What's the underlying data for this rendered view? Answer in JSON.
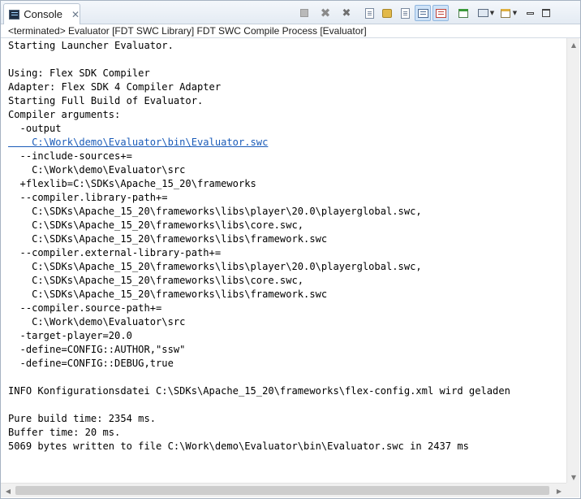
{
  "tab": {
    "label": "Console",
    "close": "✕"
  },
  "toolbar": {
    "buttons": [
      {
        "name": "terminate-button",
        "icon": "stop-icon",
        "pressed": false
      },
      {
        "name": "remove-launch-button",
        "icon": "remove-icon",
        "pressed": false
      },
      {
        "name": "remove-all-terminated-button",
        "icon": "remove-all-icon",
        "pressed": false
      },
      {
        "name": "clear-console-button",
        "icon": "clear-console-icon",
        "pressed": false
      },
      {
        "name": "scroll-lock-button",
        "icon": "scroll-lock-icon",
        "pressed": false
      },
      {
        "name": "word-wrap-button",
        "icon": "word-wrap-icon",
        "pressed": false
      },
      {
        "name": "show-on-stdout-button",
        "icon": "show-stdout-icon",
        "pressed": true
      },
      {
        "name": "show-on-stderr-button",
        "icon": "show-stderr-icon",
        "pressed": true
      },
      {
        "name": "pin-console-button",
        "icon": "pin-console-icon",
        "pressed": false
      },
      {
        "name": "display-console-button",
        "icon": "display-console-icon",
        "pressed": false
      },
      {
        "name": "open-console-button",
        "icon": "open-console-icon",
        "pressed": false
      },
      {
        "name": "minimize-button",
        "icon": "minimize-icon",
        "pressed": false
      },
      {
        "name": "maximize-button",
        "icon": "maximize-icon",
        "pressed": false
      }
    ]
  },
  "process": {
    "label": "<terminated> Evaluator [FDT SWC Library] FDT SWC Compile Process [Evaluator]"
  },
  "console": {
    "lines": [
      "Starting Launcher Evaluator.",
      "",
      "Using: Flex SDK Compiler",
      "Adapter: Flex SDK 4 Compiler Adapter",
      "Starting Full Build of Evaluator.",
      "Compiler arguments:",
      "  -output",
      "    C:\\Work\\demo\\Evaluator\\bin\\Evaluator.swc",
      "  --include-sources+=",
      "    C:\\Work\\demo\\Evaluator\\src",
      "  +flexlib=C:\\SDKs\\Apache_15_20\\frameworks",
      "  --compiler.library-path+=",
      "    C:\\SDKs\\Apache_15_20\\frameworks\\libs\\player\\20.0\\playerglobal.swc,",
      "    C:\\SDKs\\Apache_15_20\\frameworks\\libs\\core.swc,",
      "    C:\\SDKs\\Apache_15_20\\frameworks\\libs\\framework.swc",
      "  --compiler.external-library-path+=",
      "    C:\\SDKs\\Apache_15_20\\frameworks\\libs\\player\\20.0\\playerglobal.swc,",
      "    C:\\SDKs\\Apache_15_20\\frameworks\\libs\\core.swc,",
      "    C:\\SDKs\\Apache_15_20\\frameworks\\libs\\framework.swc",
      "  --compiler.source-path+=",
      "    C:\\Work\\demo\\Evaluator\\src",
      "  -target-player=20.0",
      "  -define=CONFIG::AUTHOR,\"ssw\"",
      "  -define=CONFIG::DEBUG,true",
      "",
      "INFO Konfigurationsdatei C:\\SDKs\\Apache_15_20\\frameworks\\flex-config.xml wird geladen",
      "",
      "Pure build time: 2354 ms.",
      "Buffer time: 20 ms.",
      "5069 bytes written to file C:\\Work\\demo\\Evaluator\\bin\\Evaluator.swc in 2437 ms"
    ]
  },
  "scroll": {
    "up": "▲",
    "down": "▼",
    "left": "◀",
    "right": "▶"
  }
}
